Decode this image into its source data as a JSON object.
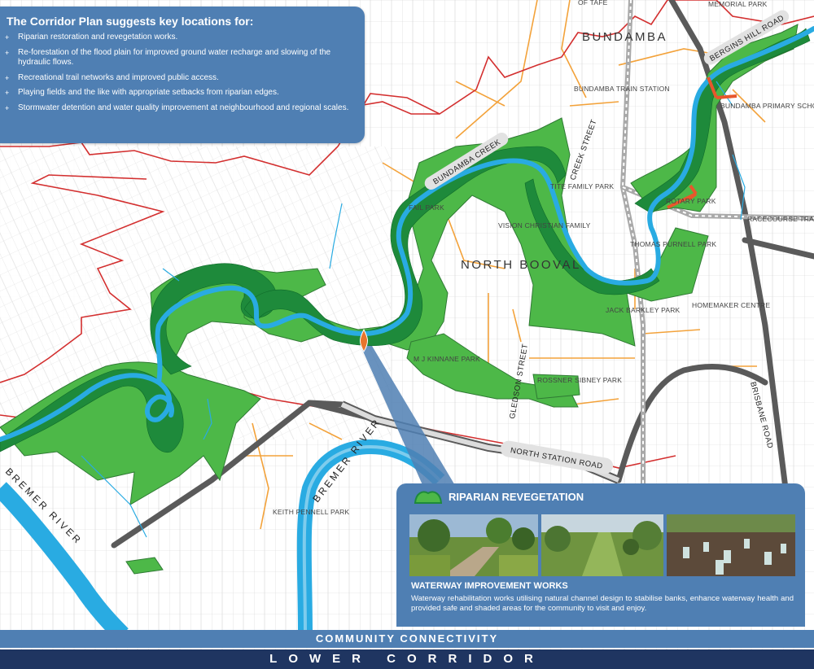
{
  "info_panel": {
    "title": "The Corridor Plan suggests key locations for:",
    "items": [
      "Riparian restoration and revegetation works.",
      "Re-forestation of the flood plain for improved ground water recharge and slowing of the hydraulic flows.",
      "Recreational trail networks and improved public access.",
      "Playing fields and the like with appropriate setbacks from riparian edges.",
      "Stormwater detention and water quality improvement at neighbourhood and regional scales."
    ]
  },
  "map_labels": {
    "suburb_bundamba": "BUNDAMBA",
    "suburb_north_booval": "NORTH BOOVAL",
    "of_tafe": "OF TAFE",
    "memorial_park": "MEMORIAL PARK",
    "bergins_hill_road": "BERGINS HILL ROAD",
    "bundamba_train_station": "BUNDAMBA TRAIN STATION",
    "bundamba_primary_school": "BUNDAMBA PRIMARY SCHOOL",
    "creek_street": "CREEK STREET",
    "bundamba_creek": "BUNDAMBA CREEK",
    "tite_family_park": "TITE FAMILY PARK",
    "fail_park": "FAIL PARK",
    "vision_christian_family": "VISION CHRISTIAN FAMILY",
    "rotary_park": "ROTARY PARK",
    "racecourse_train_station": "RACECOURSE TRAIN STATION",
    "thomas_purnell_park": "THOMAS PURNELL PARK",
    "homemaker_centre": "HOMEMAKER CENTRE",
    "jack_barkley_park": "JACK BARKLEY PARK",
    "mj_kinnane_park": "M J KINNANE PARK",
    "gledson_street": "GLEDSON STREET",
    "rossner_sibney_park": "ROSSNER SIBNEY PARK",
    "brisbane_road": "BRISBANE ROAD",
    "north_station_road": "NORTH STATION ROAD",
    "bremer_river_left": "BREMER RIVER",
    "bremer_river_center": "BREMER RIVER",
    "keith_pennell_park": "KEITH PENNELL PARK"
  },
  "riparian_panel": {
    "title": "RIPARIAN REVEGETATION",
    "subtitle": "WATERWAY IMPROVEMENT WORKS",
    "description": "Waterway rehabilitation works utilising natural channel design to stabilise banks, enhance waterway health and provided safe and shaded areas for the community to visit and enjoy."
  },
  "footer": {
    "band1": "COMMUNITY CONNECTIVITY",
    "band2": "LOWER CORRIDOR"
  },
  "colors": {
    "panel_blue": "#4f7fb3",
    "footer_navy": "#1f3561",
    "vegetation_green": "#4db848",
    "green_dark": "#17922e",
    "creek_blue": "#29abe2",
    "boundary_red": "#d32f2f",
    "road_orange": "#f3a23a",
    "main_road_grey": "#5a5a5a",
    "rail_grey": "#a9a9a9"
  }
}
